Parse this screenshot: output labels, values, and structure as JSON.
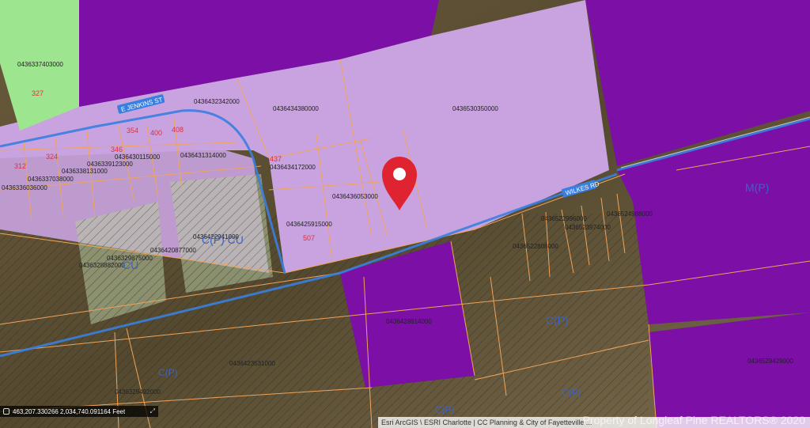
{
  "map": {
    "parcel_ids": {
      "p1": "0436337403000",
      "p2": "0436432342000",
      "p3": "0436434380000",
      "p4": "0436530350000",
      "p5": "0436430115000",
      "p6": "0436431314000",
      "p7": "0436434172000",
      "p8": "0436338131000",
      "p9": "0436339123000",
      "p10": "0436337038000",
      "p11": "0436336036000",
      "p12": "0436436053000",
      "p13": "0436425915000",
      "p14": "0436422941000",
      "p15": "0436329875000",
      "p16": "0436420877000",
      "p17": "0436328882000",
      "p18": "0436522996000",
      "p19": "0436524988000",
      "p20": "0436523974000",
      "p21": "0436522808000",
      "p22": "0436428614000",
      "p23": "0436423531000",
      "p24": "0436329492000",
      "p25": "0436529429000"
    },
    "addresses": {
      "a1": "327",
      "a2": "354",
      "a3": "400",
      "a4": "408",
      "a5": "346",
      "a6": "324",
      "a7": "312",
      "a8": "437",
      "a9": "507"
    },
    "streets": {
      "s1": "E JENKINS ST",
      "s2": "WILKES RD"
    },
    "zones": {
      "z1": "M(P)",
      "z2": "C(P)",
      "z3": "C(P)",
      "z4": "C(P)",
      "z5": "C(P)",
      "z6": "C(P) CU",
      "z7": "CU"
    },
    "colors": {
      "purple": "#7b0fa6",
      "lavender": "#c9a3e0",
      "green": "#9ee58f",
      "blue_line": "#3a7fe0",
      "parcel_line": "#f0a35a",
      "marker": "#e02330"
    }
  },
  "coordinates": {
    "readout": "463,207.330266 2,034,740.091164 Feet"
  },
  "attribution": {
    "text": "Esri ArcGIS \\ ESRI Charlotte | CC Planning & City of Fayetteville ..."
  },
  "watermark": "Property of Longleaf Pine REALTORS® 2020"
}
